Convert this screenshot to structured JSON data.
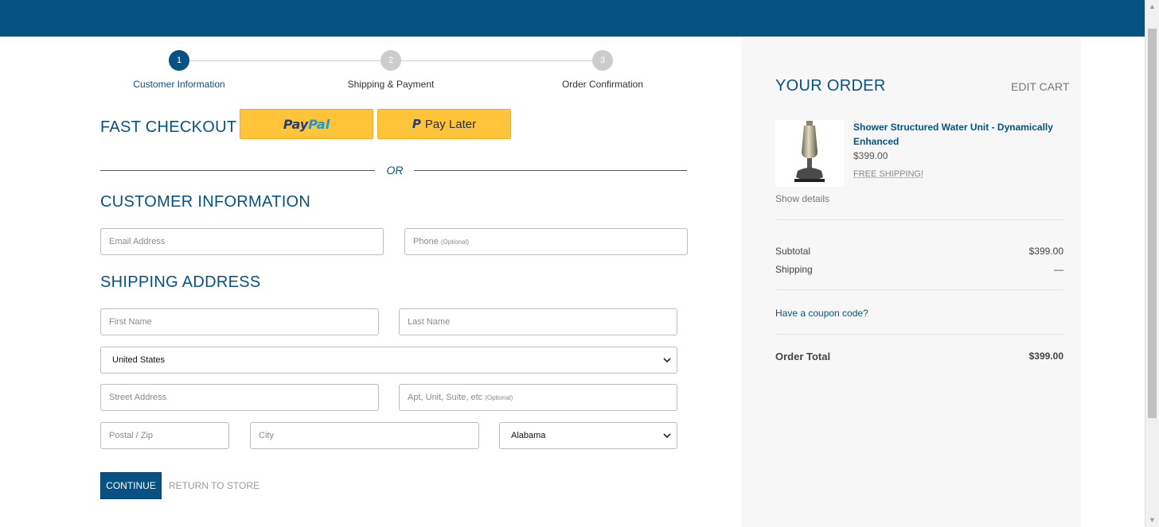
{
  "colors": {
    "brand": "#065283",
    "paypal_yellow": "#ffc439",
    "sidebar_bg": "#f7f7f7"
  },
  "steps": [
    {
      "number": "1",
      "label": "Customer Information",
      "active": true
    },
    {
      "number": "2",
      "label": "Shipping & Payment",
      "active": false
    },
    {
      "number": "3",
      "label": "Order Confirmation",
      "active": false
    }
  ],
  "fast_checkout": {
    "title": "FAST CHECKOUT",
    "paypal_pay": "Pay",
    "paypal_pal": "Pal",
    "paypal_mark": "P",
    "pay_later_label": "Pay Later"
  },
  "or_text": "OR",
  "customer_info": {
    "title": "CUSTOMER INFORMATION",
    "email_placeholder": "Email Address",
    "phone_placeholder": "Phone",
    "phone_optional": "(Optional)"
  },
  "shipping_address": {
    "title": "SHIPPING ADDRESS",
    "first_name_placeholder": "First Name",
    "last_name_placeholder": "Last Name",
    "country_value": "United States",
    "street_placeholder": "Street Address",
    "apt_placeholder": "Apt, Unit, Suite, etc",
    "apt_optional": "(Optional)",
    "zip_placeholder": "Postal / Zip",
    "city_placeholder": "City",
    "state_value": "Alabama"
  },
  "actions": {
    "continue_label": "CONTINUE",
    "return_label": "RETURN TO STORE"
  },
  "order": {
    "title": "YOUR ORDER",
    "edit_cart": "EDIT CART",
    "product_name": "Shower Structured Water Unit - Dynamically Enhanced",
    "product_price": "$399.00",
    "free_shipping": "FREE SHIPPING!",
    "show_details": "Show details",
    "subtotal_label": "Subtotal",
    "subtotal_value": "$399.00",
    "shipping_label": "Shipping",
    "shipping_value": "—",
    "coupon_link": "Have a coupon code?",
    "total_label": "Order Total",
    "total_value": "$399.00"
  },
  "icons": {
    "scroll_up": "scroll-up-arrow-icon",
    "scroll_down": "scroll-down-arrow-icon",
    "select": "chevron-down-icon"
  }
}
